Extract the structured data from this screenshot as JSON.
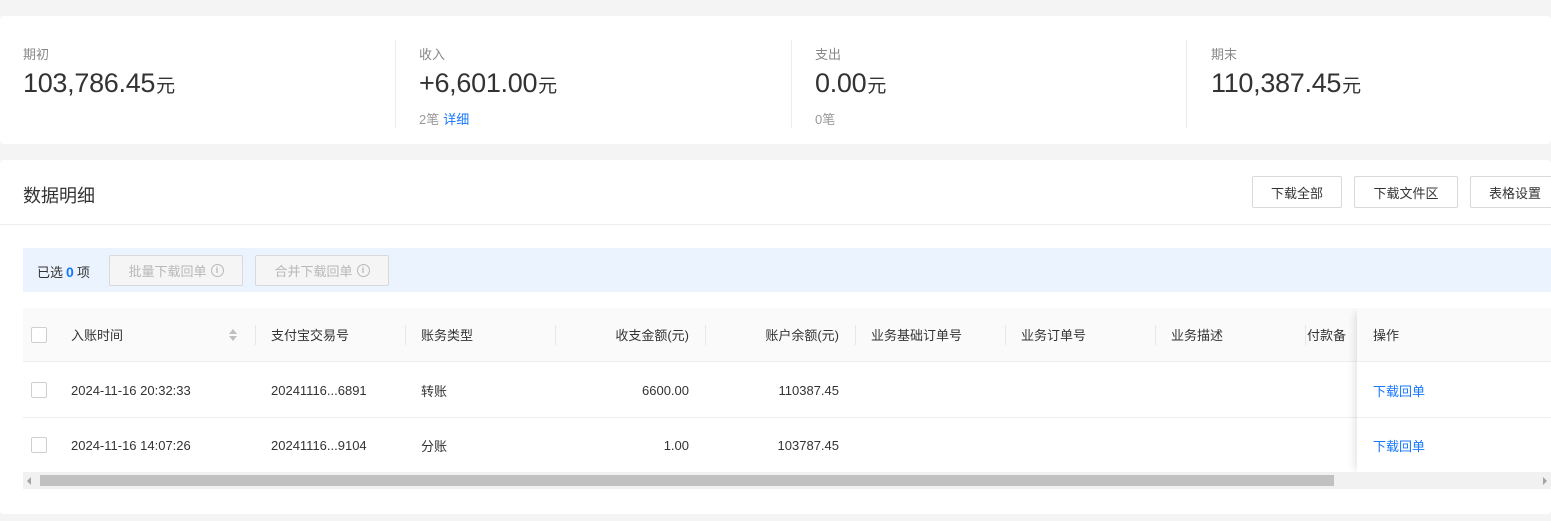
{
  "summary": {
    "opening": {
      "label": "期初",
      "amount": "103,786.45",
      "unit": "元"
    },
    "income": {
      "label": "收入",
      "amount": "+6,601.00",
      "unit": "元",
      "count": "2笔",
      "detail_link": "详细"
    },
    "expense": {
      "label": "支出",
      "amount": "0.00",
      "unit": "元",
      "count": "0笔"
    },
    "closing": {
      "label": "期末",
      "amount": "110,387.45",
      "unit": "元"
    }
  },
  "detail": {
    "title": "数据明细",
    "buttons": {
      "download_all": "下载全部",
      "download_files": "下载文件区",
      "table_settings": "表格设置"
    }
  },
  "selection": {
    "prefix": "已选",
    "count": "0",
    "suffix": "项",
    "batch_download": "批量下载回单",
    "merge_download": "合并下载回单",
    "info_glyph": "i"
  },
  "table": {
    "columns": {
      "time": "入账时间",
      "trade_no": "支付宝交易号",
      "type": "账务类型",
      "amount": "收支金额(元)",
      "balance": "账户余额(元)",
      "base_order": "业务基础订单号",
      "order": "业务订单号",
      "desc": "业务描述",
      "remark": "付款备",
      "action": "操作"
    },
    "rows": [
      {
        "time": "2024-11-16 20:32:33",
        "trade_no": "20241116...6891",
        "type": "转账",
        "amount": "6600.00",
        "balance": "110387.45",
        "base_order": "",
        "order": "",
        "desc": "",
        "remark": "",
        "action": "下载回单"
      },
      {
        "time": "2024-11-16 14:07:26",
        "trade_no": "20241116...9104",
        "type": "分账",
        "amount": "1.00",
        "balance": "103787.45",
        "base_order": "",
        "order": "",
        "desc": "",
        "remark": "",
        "action": "下载回单"
      }
    ]
  },
  "colors": {
    "accent": "#1677ff",
    "selection_bg": "#ebf3fe",
    "page_bg": "#f4f4f4"
  }
}
